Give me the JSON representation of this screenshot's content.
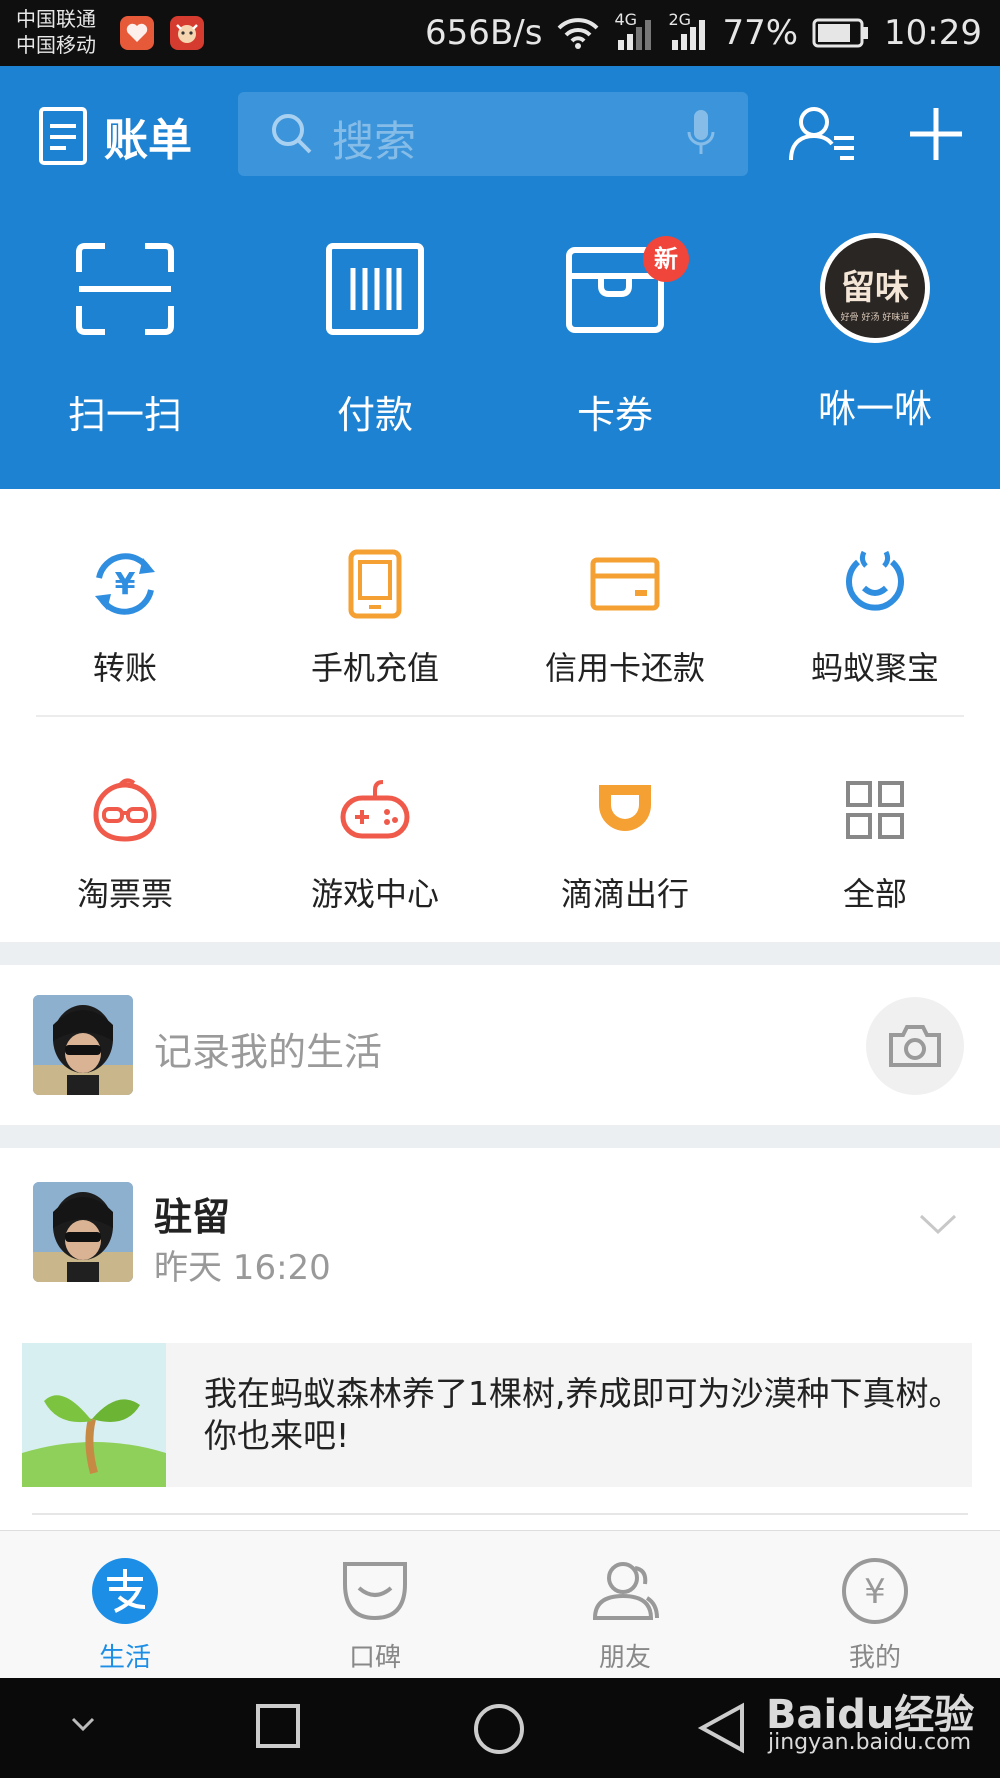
{
  "status_bar": {
    "carrier_1": "中国联通",
    "carrier_2": "中国移动",
    "net_speed": "656B/s",
    "sig1_label": "4G",
    "sig2_label": "2G",
    "battery": "77%",
    "time": "10:29"
  },
  "header": {
    "bill_label": "账单",
    "search_placeholder": "搜索",
    "actions": [
      {
        "label": "扫一扫",
        "icon": "scan-icon"
      },
      {
        "label": "付款",
        "icon": "barcode-icon"
      },
      {
        "label": "卡券",
        "icon": "card-coupon-icon",
        "badge": "新"
      },
      {
        "label": "咻一咻",
        "icon": "avatar-logo"
      }
    ],
    "logo_text": "留味",
    "logo_sub": "好骨 好汤 好味道"
  },
  "services": [
    {
      "label": "转账",
      "icon": "transfer-icon"
    },
    {
      "label": "手机充值",
      "icon": "phone-recharge-icon"
    },
    {
      "label": "信用卡还款",
      "icon": "credit-card-icon"
    },
    {
      "label": "蚂蚁聚宝",
      "icon": "ant-fortune-icon"
    },
    {
      "label": "淘票票",
      "icon": "taopiaopiao-icon"
    },
    {
      "label": "游戏中心",
      "icon": "gamepad-icon"
    },
    {
      "label": "滴滴出行",
      "icon": "didi-icon"
    },
    {
      "label": "全部",
      "icon": "grid-icon"
    }
  ],
  "record": {
    "placeholder": "记录我的生活"
  },
  "feed": {
    "user_name": "驻留",
    "time": "昨天 16:20",
    "share_text": "我在蚂蚁森林养了1棵树,养成即可为沙漠种下真树。你也来吧!"
  },
  "tabs": [
    {
      "label": "生活",
      "active": true
    },
    {
      "label": "口碑",
      "active": false
    },
    {
      "label": "朋友",
      "active": false
    },
    {
      "label": "我的",
      "active": false
    }
  ],
  "watermark": {
    "brand": "Baidu经验",
    "url": "jingyan.baidu.com"
  },
  "colors": {
    "header_blue": "#1d82d2",
    "active_tab": "#1d8ee6",
    "badge_red": "#f0453a",
    "service_blue": "#2f8ee0",
    "service_orange": "#f5a033",
    "service_red": "#f05a4a"
  }
}
